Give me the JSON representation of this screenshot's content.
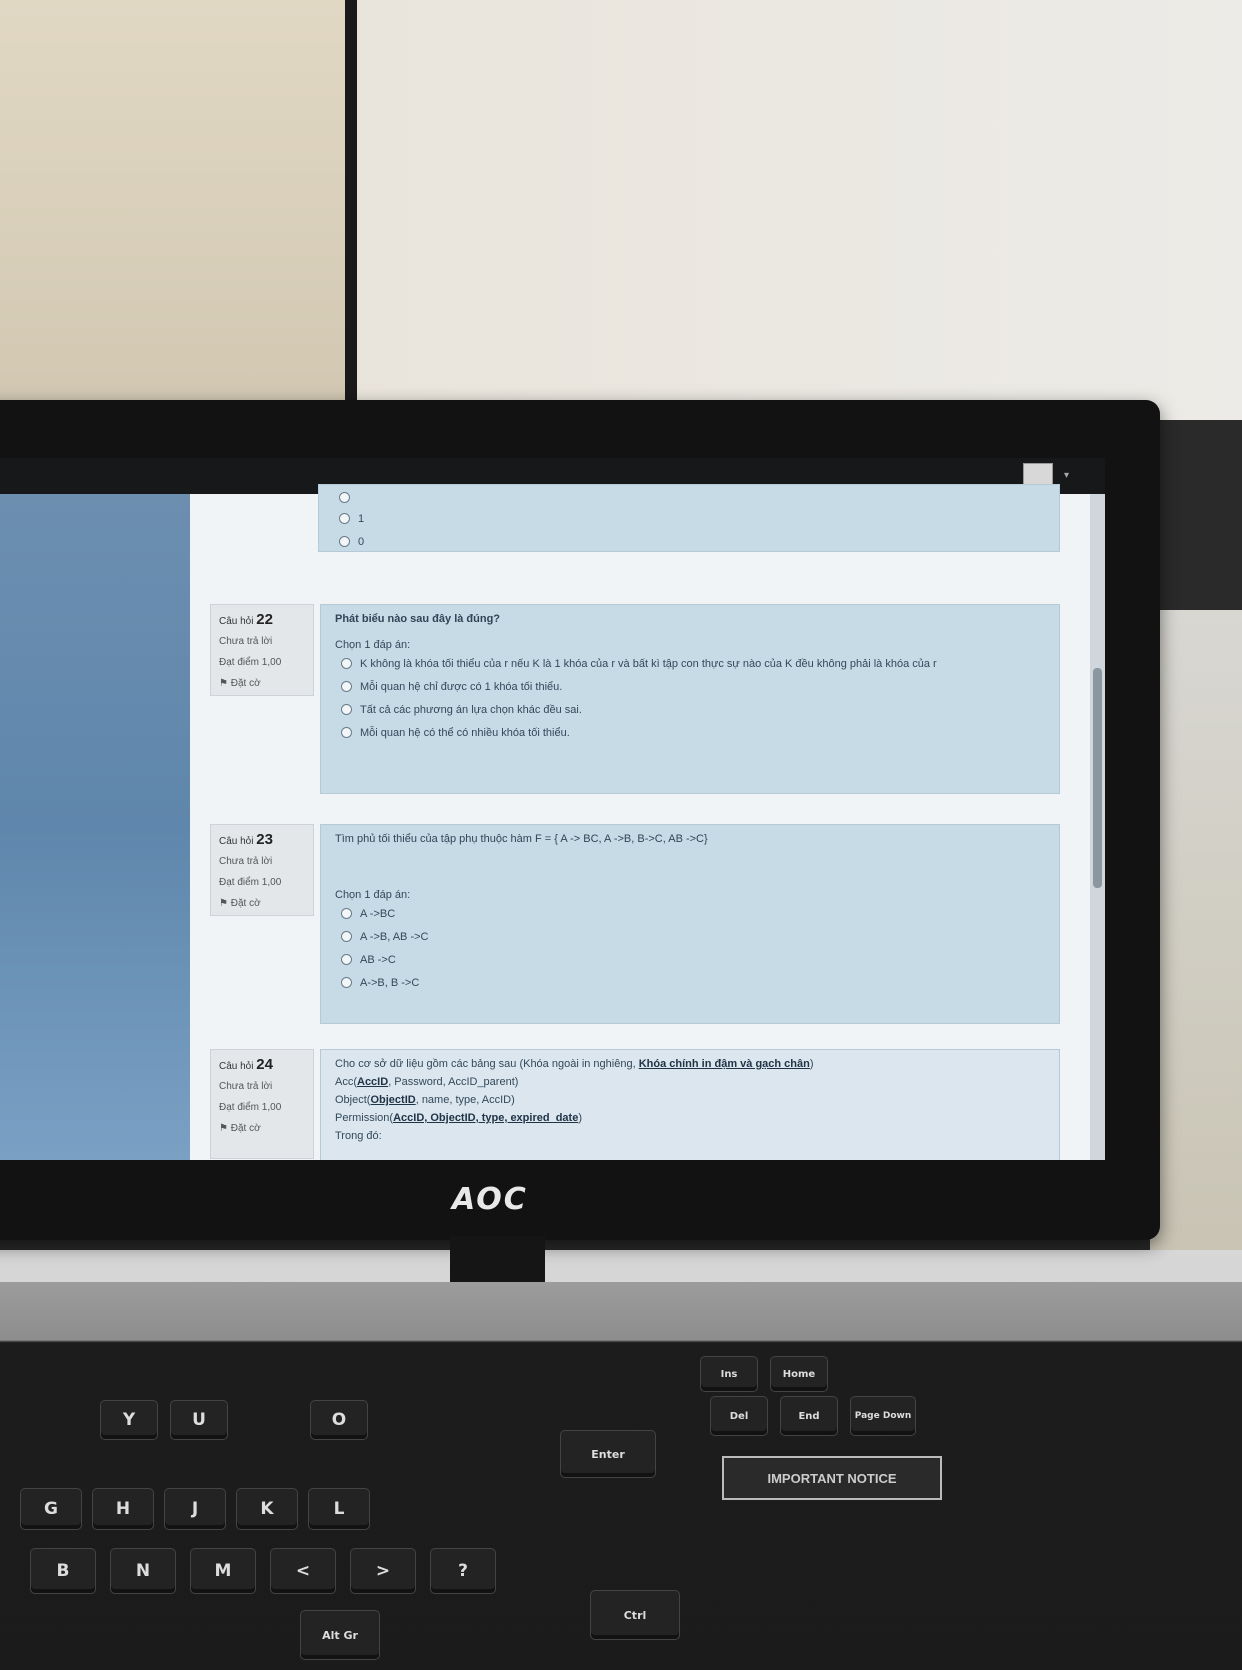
{
  "header": {
    "user_name": "",
    "avatar_icon": "user-avatar-icon"
  },
  "monitor": {
    "brand": "AOC"
  },
  "question_21_tail": {
    "options": [
      "",
      "1",
      "0"
    ]
  },
  "question_22": {
    "label": "Câu hỏi",
    "number": "22",
    "status": "Chưa trả lời",
    "score": "Đạt điểm 1,00",
    "flag_label": "Đặt cờ",
    "text": "Phát biểu nào sau đây là đúng?",
    "prompt": "Chọn 1 đáp án:",
    "options": [
      "K không là khóa tối thiểu của r nếu K là 1 khóa của r và bất kì tập con thực sự nào của K đều không phải là khóa của r",
      "Mỗi quan hệ chỉ được có 1 khóa tối thiểu.",
      "Tất cả các phương án lựa chọn khác đều sai.",
      "Mỗi quan hệ có thể có nhiều khóa tối thiểu."
    ]
  },
  "question_23": {
    "label": "Câu hỏi",
    "number": "23",
    "status": "Chưa trả lời",
    "score": "Đạt điểm 1,00",
    "flag_label": "Đặt cờ",
    "text": "Tìm phủ tối thiểu của tập phụ thuộc hàm F = { A -> BC, A ->B, B->C, AB ->C}",
    "prompt": "Chọn 1 đáp án:",
    "options": [
      "A ->BC",
      "A ->B, AB ->C",
      "AB ->C",
      "A->B, B ->C"
    ]
  },
  "question_24": {
    "label": "Câu hỏi",
    "number": "24",
    "status": "Chưa trả lời",
    "score": "Đạt điểm 1,00",
    "flag_label": "Đặt cờ",
    "text_intro": "Cho cơ sở dữ liệu gồm các bảng sau (Khóa ngoài in nghiêng, ",
    "text_emph": "Khóa chính in đậm và gạch chân",
    "text_end": ")",
    "line1_prefix": "Acc(",
    "line1_key": "AccID",
    "line1_rest": ", Password, AccID_parent)",
    "line2_prefix": "Object(",
    "line2_key": "ObjectID",
    "line2_rest": ", name, type, AccID)",
    "line3_prefix": "Permission(",
    "line3_key": "AccID, ObjectID, type, expired_date",
    "line3_rest": ")",
    "line4": "Trong đó:"
  },
  "keyboard": {
    "notice": "IMPORTANT NOTICE",
    "keys": [
      "Y",
      "U",
      "O",
      "G",
      "H",
      "J",
      "K",
      "L",
      "B",
      "N",
      "M",
      "<",
      ">",
      "?",
      "Alt Gr",
      "Ctrl",
      "Enter",
      "Del",
      "Ins",
      "Home",
      "End",
      "Page Down"
    ]
  }
}
